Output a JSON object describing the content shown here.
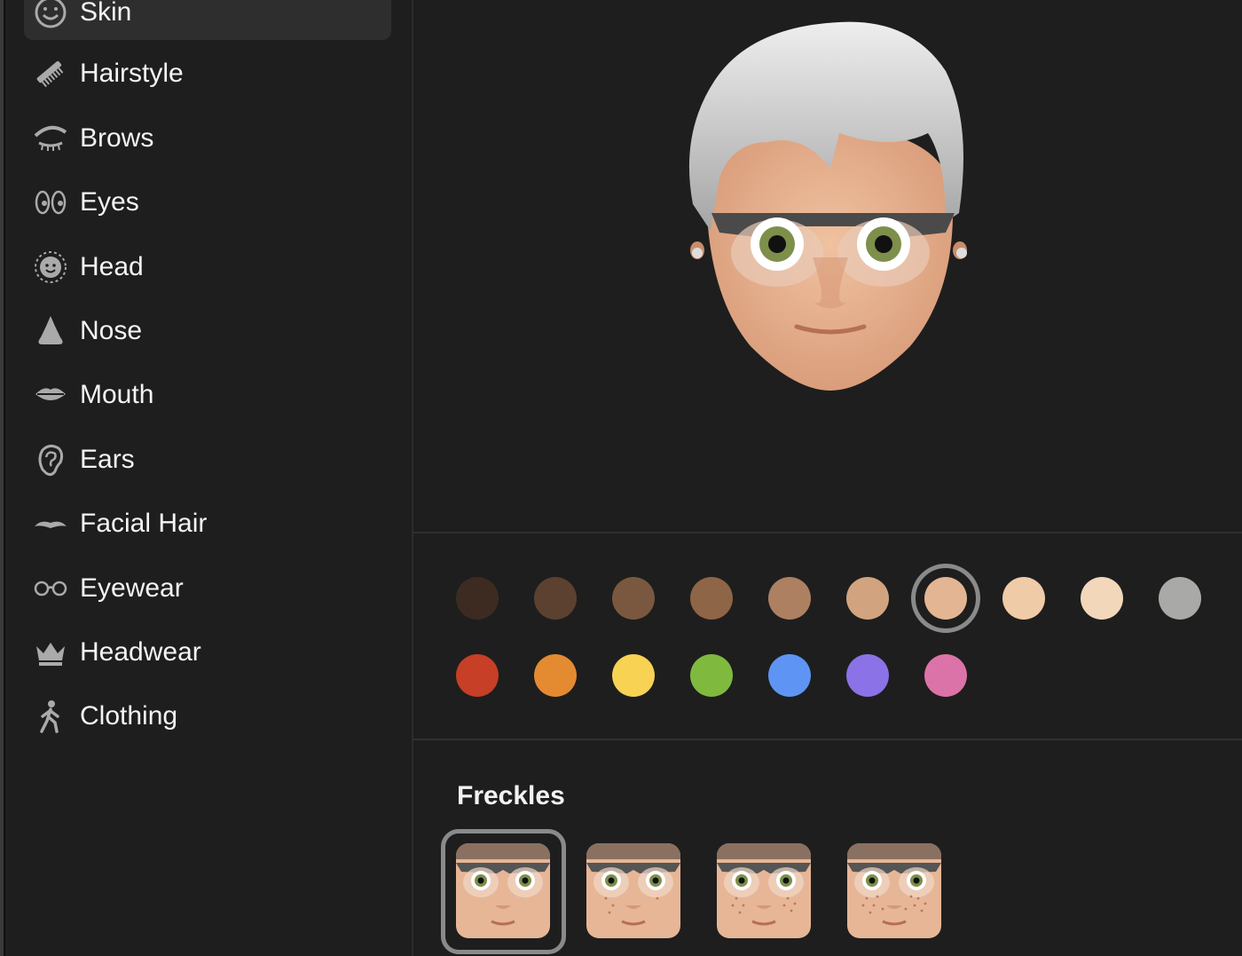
{
  "sidebar": {
    "selected": "Skin",
    "items": [
      {
        "label": "Skin",
        "icon": "smiley-freckles-icon"
      },
      {
        "label": "Hairstyle",
        "icon": "comb-icon"
      },
      {
        "label": "Brows",
        "icon": "brow-eye-icon"
      },
      {
        "label": "Eyes",
        "icon": "eyes-icon"
      },
      {
        "label": "Head",
        "icon": "head-icon"
      },
      {
        "label": "Nose",
        "icon": "nose-icon"
      },
      {
        "label": "Mouth",
        "icon": "lips-icon"
      },
      {
        "label": "Ears",
        "icon": "ear-icon"
      },
      {
        "label": "Facial Hair",
        "icon": "mustache-icon"
      },
      {
        "label": "Eyewear",
        "icon": "glasses-icon"
      },
      {
        "label": "Headwear",
        "icon": "crown-icon"
      },
      {
        "label": "Clothing",
        "icon": "figure-walk-icon"
      }
    ]
  },
  "skin_colors": {
    "selected_index": 6,
    "row1": [
      "#3d2b22",
      "#5c4030",
      "#7a5840",
      "#8e6546",
      "#ad8062",
      "#d1a47f",
      "#e4b592",
      "#f0cba8",
      "#f2d7bb",
      "#a9a9a7"
    ],
    "row2": [
      "#c63f26",
      "#e48a31",
      "#f7d253",
      "#7fba3f",
      "#5e95f5",
      "#8b72e6",
      "#dc73a8"
    ]
  },
  "freckles": {
    "title": "Freckles",
    "selected_index": 0,
    "options": [
      {
        "freckles": 0
      },
      {
        "freckles": 1
      },
      {
        "freckles": 2
      },
      {
        "freckles": 3
      }
    ]
  },
  "colors": {
    "background": "#1e1e1e",
    "selection": "#2e2e2e",
    "ring": "#8a8a8a"
  }
}
